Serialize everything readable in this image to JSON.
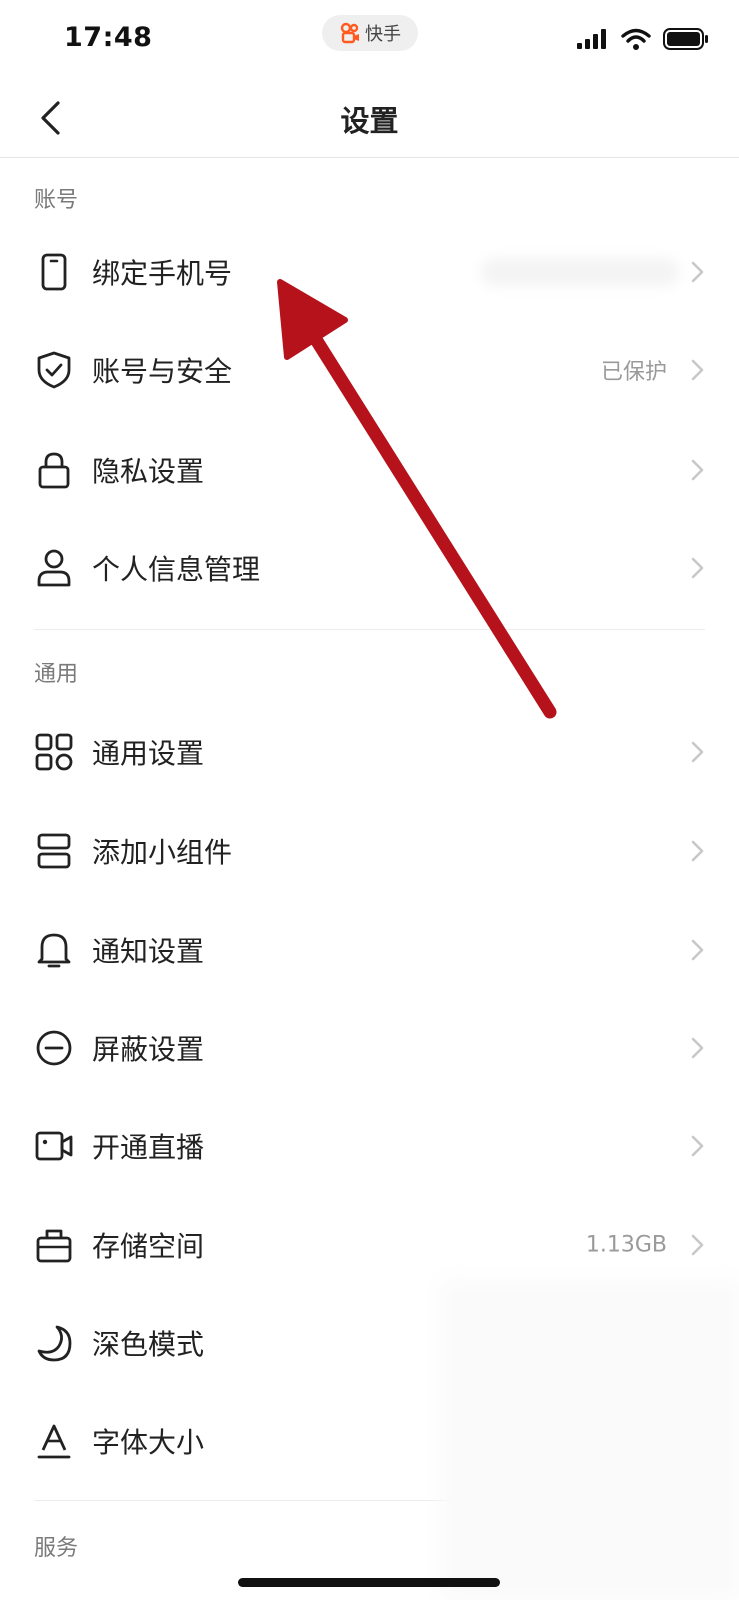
{
  "status_bar": {
    "time": "17:48",
    "app_pill_label": "快手"
  },
  "nav": {
    "title": "设置"
  },
  "sections": [
    {
      "header": "账号",
      "items": [
        {
          "label": "绑定手机号",
          "value": "",
          "icon": "phone-icon"
        },
        {
          "label": "账号与安全",
          "value": "已保护",
          "icon": "shield-check-icon"
        },
        {
          "label": "隐私设置",
          "value": "",
          "icon": "lock-icon"
        },
        {
          "label": "个人信息管理",
          "value": "",
          "icon": "person-icon"
        }
      ]
    },
    {
      "header": "通用",
      "items": [
        {
          "label": "通用设置",
          "value": "",
          "icon": "grid-icon"
        },
        {
          "label": "添加小组件",
          "value": "",
          "icon": "widget-icon"
        },
        {
          "label": "通知设置",
          "value": "",
          "icon": "bell-icon"
        },
        {
          "label": "屏蔽设置",
          "value": "",
          "icon": "block-icon"
        },
        {
          "label": "开通直播",
          "value": "",
          "icon": "video-camera-icon"
        },
        {
          "label": "存储空间",
          "value": "1.13GB",
          "icon": "storage-icon"
        },
        {
          "label": "深色模式",
          "value": "",
          "icon": "moon-icon"
        },
        {
          "label": "字体大小",
          "value": "",
          "icon": "font-size-icon"
        }
      ]
    },
    {
      "header": "服务",
      "items": []
    }
  ],
  "colors": {
    "arrow": "#b5121b",
    "text": "#222222",
    "secondary": "#9a9a9a"
  }
}
